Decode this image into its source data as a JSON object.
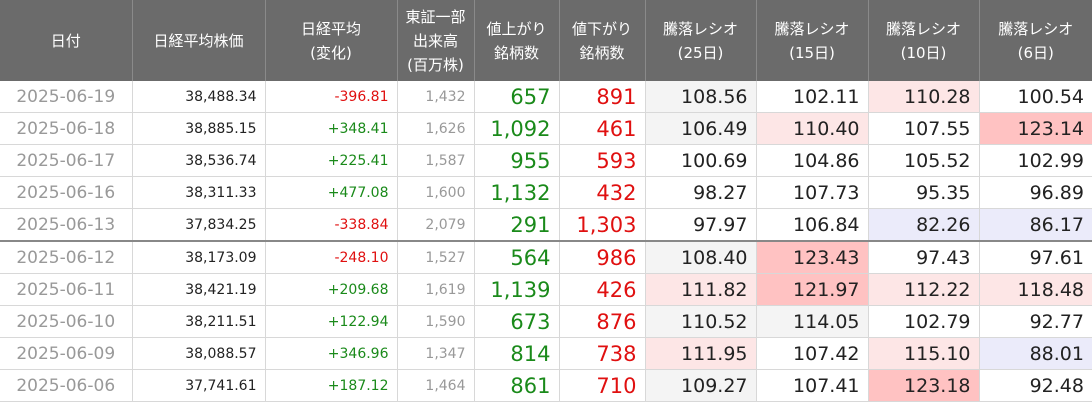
{
  "headers": [
    {
      "lines": [
        "日付"
      ]
    },
    {
      "lines": [
        "日経平均株価"
      ]
    },
    {
      "lines": [
        "日経平均",
        "(変化)"
      ]
    },
    {
      "lines": [
        "東証一部",
        "出来高",
        "(百万株)"
      ]
    },
    {
      "lines": [
        "値上がり",
        "銘柄数"
      ]
    },
    {
      "lines": [
        "値下がり",
        "銘柄数"
      ]
    },
    {
      "lines": [
        "騰落レシオ",
        "(25日)"
      ]
    },
    {
      "lines": [
        "騰落レシオ",
        "(15日)"
      ]
    },
    {
      "lines": [
        "騰落レシオ",
        "(10日)"
      ]
    },
    {
      "lines": [
        "騰落レシオ",
        "(6日)"
      ]
    }
  ],
  "rows": [
    {
      "date": "2025-06-19",
      "price": "38,488.34",
      "change": "-396.81",
      "volume": "1,432",
      "up": "657",
      "down": "891",
      "r25": "108.56",
      "r15": "102.11",
      "r10": "110.28",
      "r6": "100.54"
    },
    {
      "date": "2025-06-18",
      "price": "38,885.15",
      "change": "+348.41",
      "volume": "1,626",
      "up": "1,092",
      "down": "461",
      "r25": "106.49",
      "r15": "110.40",
      "r10": "107.55",
      "r6": "123.14"
    },
    {
      "date": "2025-06-17",
      "price": "38,536.74",
      "change": "+225.41",
      "volume": "1,587",
      "up": "955",
      "down": "593",
      "r25": "100.69",
      "r15": "104.86",
      "r10": "105.52",
      "r6": "102.99"
    },
    {
      "date": "2025-06-16",
      "price": "38,311.33",
      "change": "+477.08",
      "volume": "1,600",
      "up": "1,132",
      "down": "432",
      "r25": "98.27",
      "r15": "107.73",
      "r10": "95.35",
      "r6": "96.89"
    },
    {
      "date": "2025-06-13",
      "price": "37,834.25",
      "change": "-338.84",
      "volume": "2,079",
      "up": "291",
      "down": "1,303",
      "r25": "97.97",
      "r15": "106.84",
      "r10": "82.26",
      "r6": "86.17"
    },
    {
      "date": "2025-06-12",
      "price": "38,173.09",
      "change": "-248.10",
      "volume": "1,527",
      "up": "564",
      "down": "986",
      "r25": "108.40",
      "r15": "123.43",
      "r10": "97.43",
      "r6": "97.61"
    },
    {
      "date": "2025-06-11",
      "price": "38,421.19",
      "change": "+209.68",
      "volume": "1,619",
      "up": "1,139",
      "down": "426",
      "r25": "111.82",
      "r15": "121.97",
      "r10": "112.22",
      "r6": "118.48"
    },
    {
      "date": "2025-06-10",
      "price": "38,211.51",
      "change": "+122.94",
      "volume": "1,590",
      "up": "673",
      "down": "876",
      "r25": "110.52",
      "r15": "114.05",
      "r10": "102.79",
      "r6": "92.77"
    },
    {
      "date": "2025-06-09",
      "price": "38,088.57",
      "change": "+346.96",
      "volume": "1,347",
      "up": "814",
      "down": "738",
      "r25": "111.95",
      "r15": "107.42",
      "r10": "115.10",
      "r6": "88.01"
    },
    {
      "date": "2025-06-06",
      "price": "37,741.61",
      "change": "+187.12",
      "volume": "1,464",
      "up": "861",
      "down": "710",
      "r25": "109.27",
      "r15": "107.41",
      "r10": "123.18",
      "r6": "92.48"
    }
  ],
  "colors": {
    "header_bg": "#6b6b6b",
    "positive": "#1a8a1a",
    "negative": "#e01010",
    "highlight_strong": "#ffc2c2",
    "highlight_light": "#fde6e6",
    "highlight_blue": "#ebebfa"
  }
}
